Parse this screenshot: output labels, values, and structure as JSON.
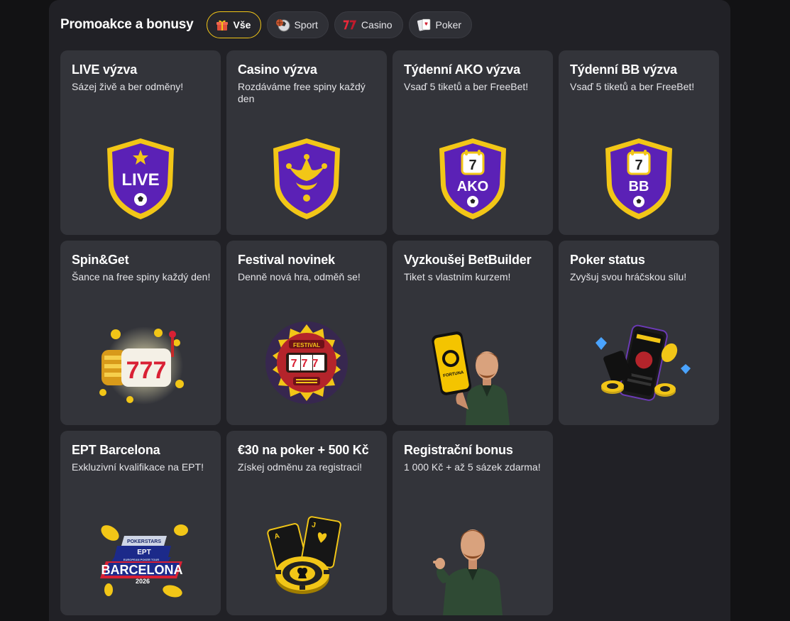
{
  "header": {
    "title": "Promoakce a bonusy",
    "filters": [
      {
        "label": "Vše",
        "icon": "gift-icon",
        "active": true
      },
      {
        "label": "Sport",
        "icon": "ball-icon",
        "active": false
      },
      {
        "label": "Casino",
        "icon": "seven-icon",
        "active": false
      },
      {
        "label": "Poker",
        "icon": "cards-icon",
        "active": false
      }
    ]
  },
  "cards": [
    {
      "title": "LIVE výzva",
      "subtitle": "Sázej živě a ber odměny!",
      "art": "live-shield-icon",
      "badge": "LIVE"
    },
    {
      "title": "Casino výzva",
      "subtitle": "Rozdáváme free spiny každý den",
      "art": "jester-shield-icon"
    },
    {
      "title": "Týdenní AKO výzva",
      "subtitle": "Vsaď 5 tiketů a ber FreeBet!",
      "art": "ako-shield-icon",
      "badge": "AKO",
      "calendar": "7"
    },
    {
      "title": "Týdenní BB výzva",
      "subtitle": "Vsaď 5 tiketů a ber FreeBet!",
      "art": "bb-shield-icon",
      "badge": "BB",
      "calendar": "7"
    },
    {
      "title": "Spin&Get",
      "subtitle": "Šance na free spiny každý den!",
      "art": "slot-777-icon",
      "badge": "777"
    },
    {
      "title": "Festival novinek",
      "subtitle": "Denně nová hra, odměň se!",
      "art": "festival-slot-icon",
      "badge": "FESTIVAL",
      "reels": "777"
    },
    {
      "title": "Vyzkoušej BetBuilder",
      "subtitle": "Tiket s vlastním kurzem!",
      "art": "man-with-phone-icon",
      "badge": "FORTUNA"
    },
    {
      "title": "Poker status",
      "subtitle": "Zvyšuj svou hráčskou sílu!",
      "art": "phone-chips-icon"
    },
    {
      "title": "EPT Barcelona",
      "subtitle": "Exkluzivní kvalifikace na EPT!",
      "art": "ept-barcelona-logo-icon",
      "badge": "BARCELONA",
      "badge_top": "POKERSTARS",
      "badge_mid": "EPT",
      "badge_sub": "EUROPEAN POKER TOUR",
      "badge_year": "2026"
    },
    {
      "title": "€30 na poker + 500 Kč",
      "subtitle": "Získej odměnu za registraci!",
      "art": "poker-chip-cards-icon"
    },
    {
      "title": "Registrační bonus",
      "subtitle": "1 000 Kč + až 5 sázek zdarma!",
      "art": "man-pointing-icon"
    }
  ],
  "colors": {
    "accent": "#f2c617",
    "shield_purple": "#5b21b6",
    "card_bg": "#33343a",
    "panel_bg": "#212126"
  }
}
